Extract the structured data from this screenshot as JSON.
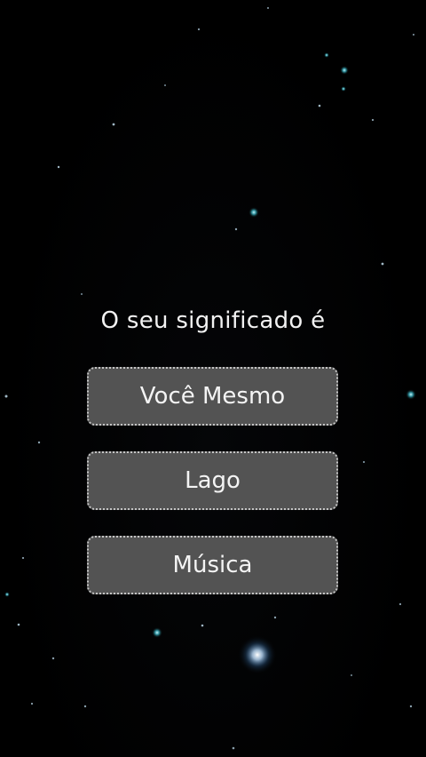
{
  "quiz": {
    "question": "O seu significado é",
    "options": [
      {
        "label": "Você Mesmo"
      },
      {
        "label": "Lago"
      },
      {
        "label": "Música"
      }
    ]
  },
  "colors": {
    "background": "#000000",
    "star_white": "#dfe6ea",
    "star_teal": "#4fd8e8",
    "button_fill": "#535353",
    "text": "#f4f4f4"
  }
}
